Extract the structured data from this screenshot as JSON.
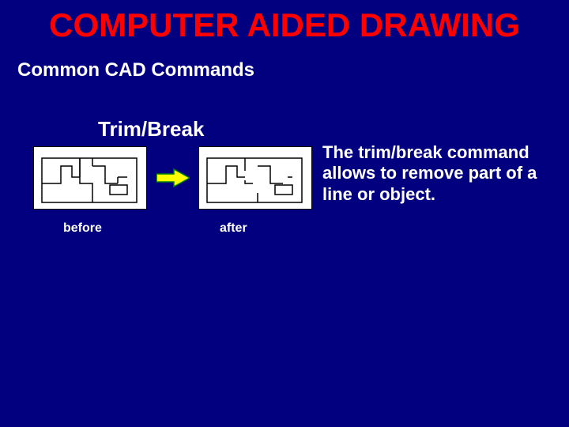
{
  "title": "COMPUTER AIDED DRAWING",
  "subtitle": "Common CAD Commands",
  "section": "Trim/Break",
  "description": "The trim/break command allows to remove part of a line or object.",
  "captions": {
    "before": "before",
    "after": "after"
  },
  "icons": {
    "arrow": "arrow-right-icon"
  },
  "colors": {
    "bg": "#02007f",
    "accent": "#ff0000",
    "text": "#ffffff",
    "arrow": "#ffff00",
    "arrowStroke": "#008000"
  }
}
